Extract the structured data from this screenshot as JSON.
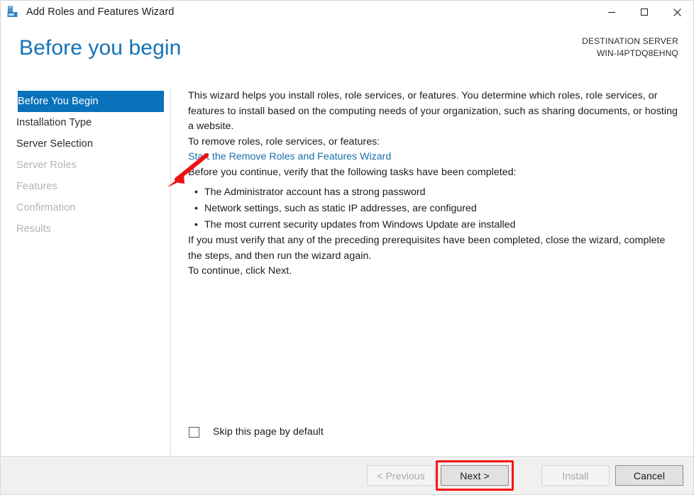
{
  "window": {
    "title": "Add Roles and Features Wizard",
    "icon": "server-roles-icon",
    "controls": {
      "minimize": "minimize-icon",
      "maximize": "maximize-icon",
      "close": "close-icon"
    }
  },
  "header": {
    "page_title": "Before you begin",
    "destination_label": "DESTINATION SERVER",
    "destination_server": "WIN-I4PTDQ8EHNQ"
  },
  "sidebar": {
    "items": [
      {
        "label": "Before You Begin",
        "state": "selected"
      },
      {
        "label": "Installation Type",
        "state": "enabled"
      },
      {
        "label": "Server Selection",
        "state": "enabled"
      },
      {
        "label": "Server Roles",
        "state": "disabled"
      },
      {
        "label": "Features",
        "state": "disabled"
      },
      {
        "label": "Confirmation",
        "state": "disabled"
      },
      {
        "label": "Results",
        "state": "disabled"
      }
    ]
  },
  "content": {
    "intro": "This wizard helps you install roles, role services, or features. You determine which roles, role services, or features to install based on the computing needs of your organization, such as sharing documents, or hosting a website.",
    "remove_heading": "To remove roles, role services, or features:",
    "remove_link": "Start the Remove Roles and Features Wizard",
    "verify_heading": "Before you continue, verify that the following tasks have been completed:",
    "tasks": [
      "The Administrator account has a strong password",
      "Network settings, such as static IP addresses, are configured",
      "The most current security updates from Windows Update are installed"
    ],
    "prereq_note": "If you must verify that any of the preceding prerequisites have been completed, close the wizard, complete the steps, and then run the wizard again.",
    "continue_note": "To continue, click Next.",
    "skip_checkbox_label": "Skip this page by default",
    "skip_checkbox_checked": false
  },
  "footer": {
    "previous": "< Previous",
    "next": "Next >",
    "install": "Install",
    "cancel": "Cancel",
    "previous_enabled": false,
    "next_enabled": true,
    "install_enabled": false,
    "cancel_enabled": true
  },
  "annotations": {
    "arrow_color": "#ee1111",
    "arrow_target": "Before You Begin",
    "highlight_color": "#f71414",
    "highlight_target": "Next >"
  },
  "colors": {
    "accent_blue": "#0a72bb",
    "title_blue": "#1572b5",
    "link_blue": "#1a6fa8",
    "footer_bg": "#f0f0f0",
    "annotation_red": "#f71414"
  }
}
